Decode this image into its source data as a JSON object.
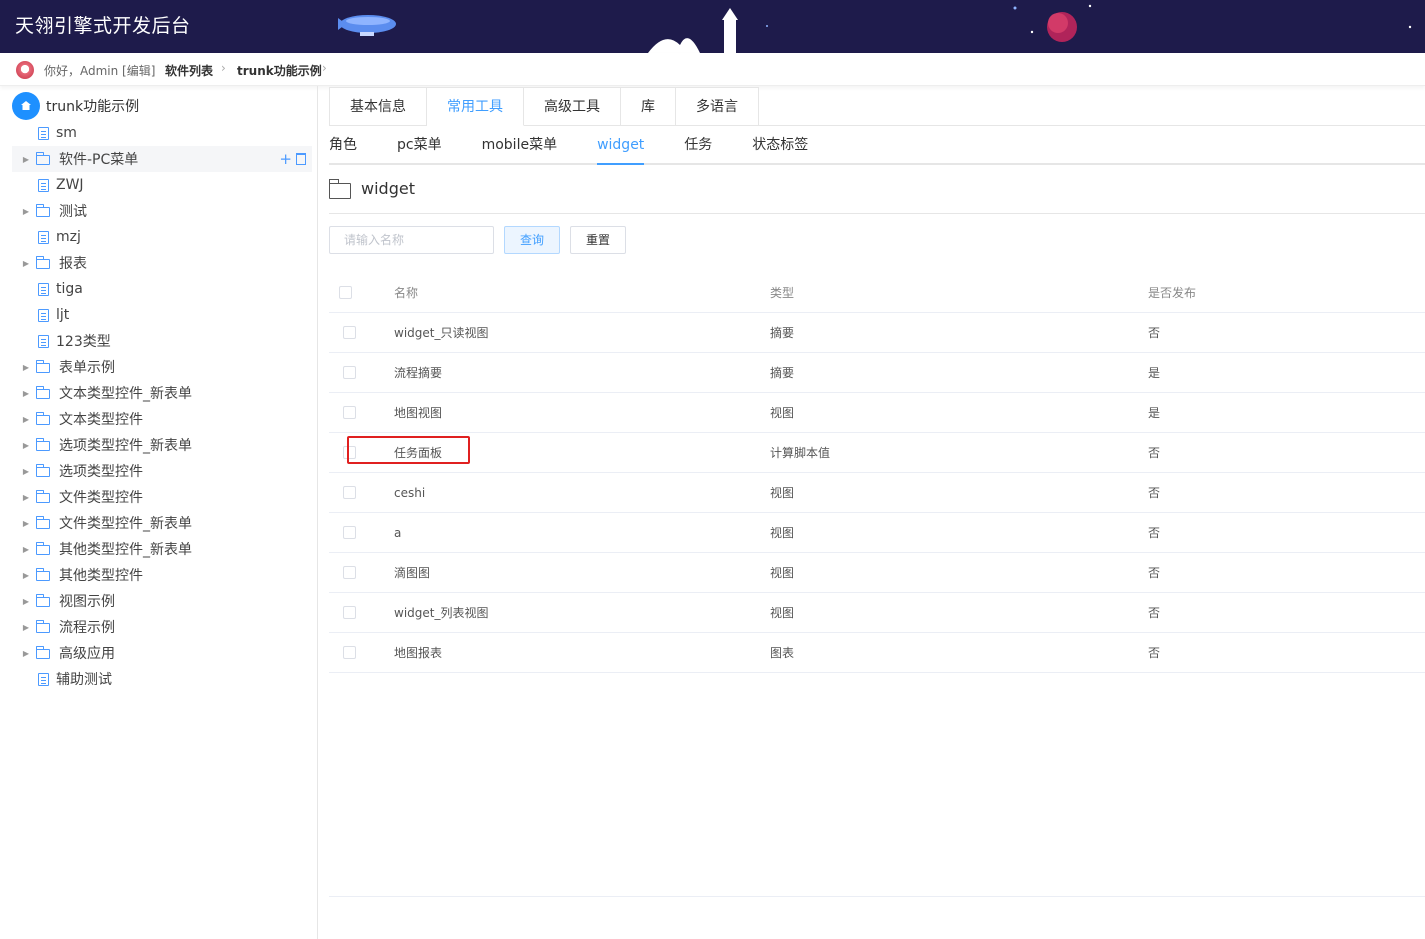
{
  "app": {
    "title": "天翎引擎式开发后台"
  },
  "breadcrumb": {
    "greeting": "你好，Admin [编辑]",
    "items": [
      "软件列表",
      "trunk功能示例"
    ]
  },
  "sidebar": {
    "root": "trunk功能示例",
    "items": [
      {
        "label": "sm",
        "type": "file"
      },
      {
        "label": "软件-PC菜单",
        "type": "folder",
        "hover": true
      },
      {
        "label": "ZWJ",
        "type": "file"
      },
      {
        "label": "测试",
        "type": "folder"
      },
      {
        "label": "mzj",
        "type": "file"
      },
      {
        "label": "报表",
        "type": "folder"
      },
      {
        "label": "tiga",
        "type": "file"
      },
      {
        "label": "ljt",
        "type": "file"
      },
      {
        "label": "123类型",
        "type": "file"
      },
      {
        "label": "表单示例",
        "type": "folder"
      },
      {
        "label": "文本类型控件_新表单",
        "type": "folder"
      },
      {
        "label": "文本类型控件",
        "type": "folder"
      },
      {
        "label": "选项类型控件_新表单",
        "type": "folder"
      },
      {
        "label": "选项类型控件",
        "type": "folder"
      },
      {
        "label": "文件类型控件",
        "type": "folder"
      },
      {
        "label": "文件类型控件_新表单",
        "type": "folder"
      },
      {
        "label": "其他类型控件_新表单",
        "type": "folder"
      },
      {
        "label": "其他类型控件",
        "type": "folder"
      },
      {
        "label": "视图示例",
        "type": "folder"
      },
      {
        "label": "流程示例",
        "type": "folder"
      },
      {
        "label": "高级应用",
        "type": "folder"
      },
      {
        "label": "辅助测试",
        "type": "file"
      }
    ]
  },
  "tabs_primary": [
    {
      "label": "基本信息",
      "active": false
    },
    {
      "label": "常用工具",
      "active": true
    },
    {
      "label": "高级工具",
      "active": false
    },
    {
      "label": "库",
      "active": false
    },
    {
      "label": "多语言",
      "active": false
    }
  ],
  "tabs_secondary": [
    {
      "label": "角色",
      "active": false
    },
    {
      "label": "pc菜单",
      "active": false
    },
    {
      "label": "mobile菜单",
      "active": false
    },
    {
      "label": "widget",
      "active": true
    },
    {
      "label": "任务",
      "active": false
    },
    {
      "label": "状态标签",
      "active": false
    }
  ],
  "section": {
    "title": "widget"
  },
  "search": {
    "placeholder": "请输入名称",
    "query_label": "查询",
    "reset_label": "重置"
  },
  "table": {
    "headers": [
      "名称",
      "类型",
      "是否发布"
    ],
    "rows": [
      [
        "widget_只读视图",
        "摘要",
        "否"
      ],
      [
        "流程摘要",
        "摘要",
        "是"
      ],
      [
        "地图视图",
        "视图",
        "是"
      ],
      [
        "任务面板",
        "计算脚本值",
        "否"
      ],
      [
        "ceshi",
        "视图",
        "否"
      ],
      [
        "a",
        "视图",
        "否"
      ],
      [
        "滴图图",
        "视图",
        "否"
      ],
      [
        "widget_列表视图",
        "视图",
        "否"
      ],
      [
        "地图报表",
        "图表",
        "否"
      ]
    ]
  },
  "colors": {
    "header_bg": "#1e1b4b",
    "accent": "#409eff",
    "highlight": "#e02020"
  }
}
